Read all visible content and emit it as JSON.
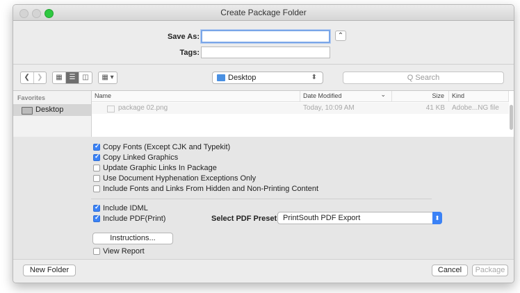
{
  "window": {
    "title": "Create Package Folder",
    "title_bar_colors": {
      "close": "#d4d4d4",
      "minimize": "#d4d4d4",
      "zoom": "#2ec840"
    }
  },
  "save_panel": {
    "save_as_label": "Save As:",
    "save_as_value": "",
    "tags_label": "Tags:",
    "tags_value": "",
    "collapse_glyph": "⌃"
  },
  "toolbar": {
    "back_glyph": "❮",
    "forward_glyph": "❯",
    "view_icons": [
      "icon-view-icon",
      "list-view-icon",
      "column-view-icon"
    ],
    "arrange_glyph": "▦ ▾",
    "location": "Desktop",
    "location_arrows": "⬍",
    "search_placeholder": "Q Search"
  },
  "sidebar": {
    "heading": "Favorites",
    "items": [
      {
        "label": "Desktop",
        "selected": true
      }
    ]
  },
  "file_list": {
    "columns": [
      "Name",
      "Date Modified",
      "Size",
      "Kind"
    ],
    "sort_glyph": "⌄",
    "rows": [
      {
        "name": "package 02.png",
        "date": "Today, 10:09 AM",
        "size": "41 KB",
        "kind": "Adobe...NG file"
      }
    ]
  },
  "options": {
    "checkboxes": [
      {
        "label": "Copy Fonts (Except CJK and Typekit)",
        "checked": true
      },
      {
        "label": "Copy Linked Graphics",
        "checked": true
      },
      {
        "label": "Update Graphic Links In Package",
        "checked": false
      },
      {
        "label": "Use Document Hyphenation Exceptions Only",
        "checked": false
      },
      {
        "label": "Include Fonts and Links From Hidden and Non-Printing Content",
        "checked": false
      },
      {
        "label": "Include IDML",
        "checked": true
      },
      {
        "label": "Include PDF(Print)",
        "checked": true
      },
      {
        "label": "View Report",
        "checked": false
      }
    ],
    "pdf_preset_label": "Select PDF Preset:",
    "pdf_preset_value": "PrintSouth PDF Export",
    "instructions_button": "Instructions..."
  },
  "footer": {
    "new_folder": "New Folder",
    "cancel": "Cancel",
    "package": "Package"
  },
  "accent_color": "#3b82f6"
}
